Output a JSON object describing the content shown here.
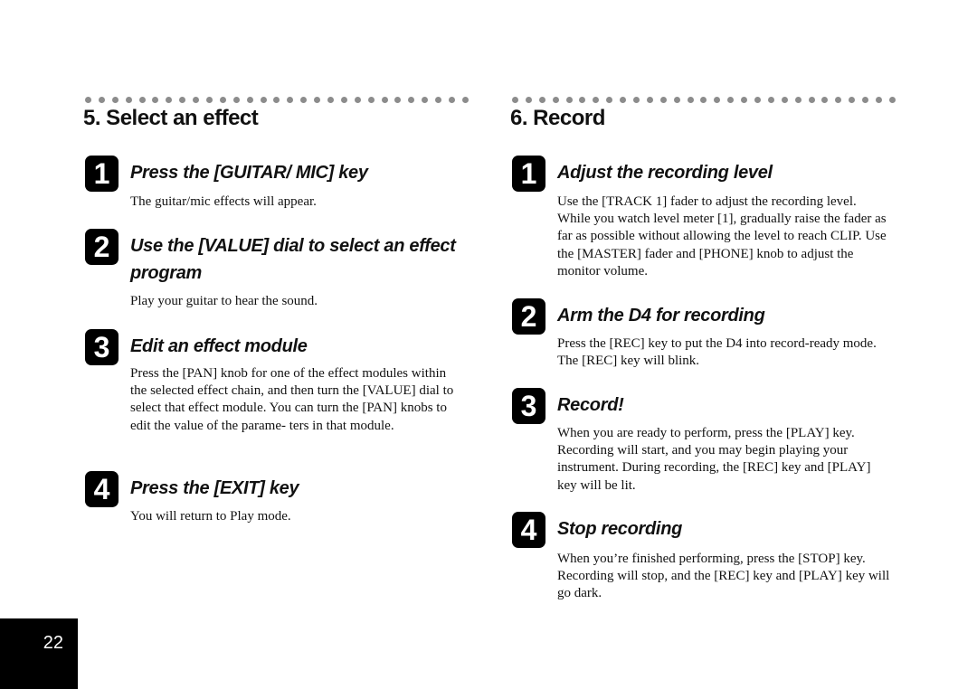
{
  "left_section": {
    "title": "5. Select an effect",
    "steps": [
      {
        "number": "1",
        "title": "Press the [GUITAR/ MIC] key",
        "body": "The guitar/mic effects will appear."
      },
      {
        "number": "2",
        "title": "Use the [VALUE] dial to select an effect program",
        "body": "Play your guitar to hear the sound."
      },
      {
        "number": "3",
        "title": "Edit an effect module",
        "body": "Press the [PAN] knob for one of the effect modules within the selected effect chain, and then turn the [VALUE] dial to select that effect module. You can turn the [PAN] knobs to edit the value of the parame- ters in that module."
      },
      {
        "number": "4",
        "title": "Press the [EXIT] key",
        "body": "You will return to Play mode."
      }
    ]
  },
  "right_section": {
    "title": "6. Record",
    "steps": [
      {
        "number": "1",
        "title": "Adjust the recording level",
        "body": "Use the [TRACK 1] fader to adjust the recording level. While you watch level meter [1], gradually raise the fader as far as possible without allowing the level to reach CLIP. Use the [MASTER] fader and [PHONE] knob to adjust the monitor volume."
      },
      {
        "number": "2",
        "title": "Arm the D4 for recording",
        "body": "Press the [REC] key to put the D4 into record-ready mode. The [REC] key will blink."
      },
      {
        "number": "3",
        "title": "Record!",
        "body": "When you are ready to perform, press the [PLAY] key. Recording will start, and you may begin playing your instrument. During recording, the [REC] key and [PLAY] key will be lit."
      },
      {
        "number": "4",
        "title": "Stop recording",
        "body": "When you’re finished performing, press the [STOP] key. Recording will stop, and the [REC] key and [PLAY] key will go dark."
      }
    ]
  },
  "page_number": "22"
}
